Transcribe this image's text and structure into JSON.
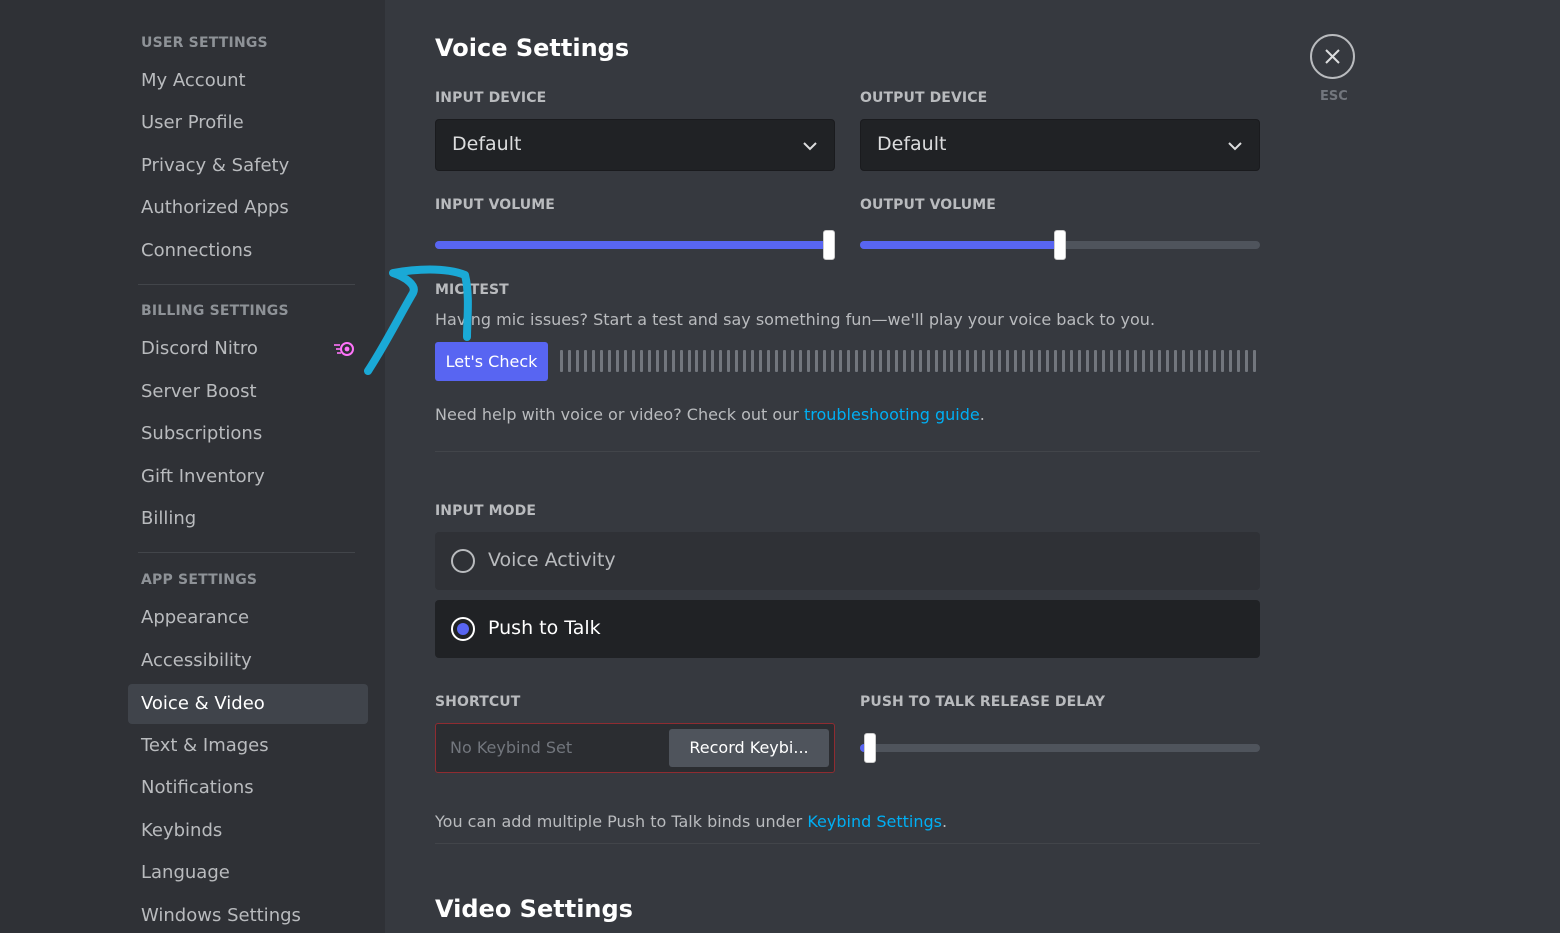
{
  "sidebar": {
    "sections": [
      {
        "header": "USER SETTINGS",
        "items": [
          "My Account",
          "User Profile",
          "Privacy & Safety",
          "Authorized Apps",
          "Connections"
        ]
      },
      {
        "header": "BILLING SETTINGS",
        "items": [
          "Discord Nitro",
          "Server Boost",
          "Subscriptions",
          "Gift Inventory",
          "Billing"
        ]
      },
      {
        "header": "APP SETTINGS",
        "items": [
          "Appearance",
          "Accessibility",
          "Voice & Video",
          "Text & Images",
          "Notifications",
          "Keybinds",
          "Language",
          "Windows Settings"
        ]
      }
    ],
    "active_item": "Voice & Video",
    "nitro_icon": "nitro-icon"
  },
  "main": {
    "title": "Voice Settings",
    "input_device": {
      "label": "INPUT DEVICE",
      "value": "Default"
    },
    "output_device": {
      "label": "OUTPUT DEVICE",
      "value": "Default"
    },
    "input_volume": {
      "label": "INPUT VOLUME",
      "level": 0.985
    },
    "output_volume": {
      "label": "OUTPUT VOLUME",
      "level": 0.5
    },
    "mic_test": {
      "label": "MIC TEST",
      "description": "Having mic issues? Start a test and say something fun—we'll play your voice back to you.",
      "button": "Let's Check"
    },
    "help": {
      "text": "Need help with voice or video? Check out our ",
      "link": "troubleshooting guide",
      "suffix": "."
    },
    "input_mode": {
      "label": "INPUT MODE",
      "options": [
        "Voice Activity",
        "Push to Talk"
      ],
      "selected": "Push to Talk"
    },
    "shortcut": {
      "label": "SHORTCUT",
      "placeholder": "No Keybind Set",
      "button": "Record Keybi..."
    },
    "release_delay": {
      "label": "PUSH TO TALK RELEASE DELAY",
      "level": 0.0
    },
    "keybind_note": {
      "text": "You can add multiple Push to Talk binds under ",
      "link": "Keybind Settings",
      "suffix": "."
    },
    "video_title": "Video Settings"
  },
  "close": {
    "icon": "close-icon",
    "label": "ESC"
  },
  "colors": {
    "accent": "#5865f2",
    "link": "#00aff4",
    "annotation": "#1aa9d6"
  }
}
